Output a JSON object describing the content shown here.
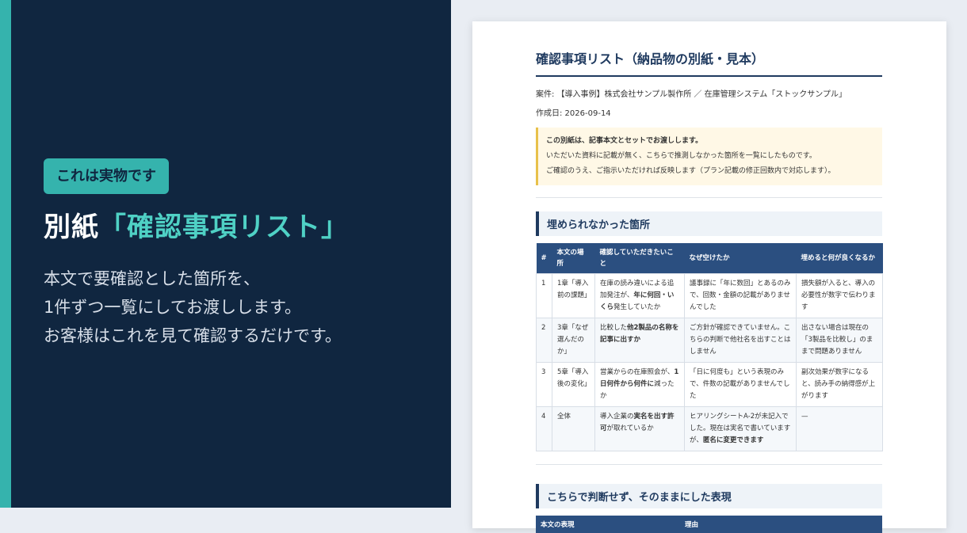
{
  "left": {
    "badge": "これは実物です",
    "headline_prefix": "別紙",
    "headline_highlight": "「確認事項リスト」",
    "lines": [
      "本文で要確認とした箇所を、",
      "1件ずつ一覧にしてお渡しします。",
      "お客様はこれを見て確認するだけです。"
    ]
  },
  "doc": {
    "title": "確認事項リスト（納品物の別紙・見本）",
    "case": "案件: 【導入事例】株式会社サンプル製作所 ／ 在庫管理システム「ストックサンプル」",
    "date": "作成日: 2026-09-14",
    "notice": {
      "line1": "この別紙は、記事本文とセットでお渡しします。",
      "line2": "いただいた資料に記載が無く、こちらで推測しなかった箇所を一覧にしたものです。",
      "line3": "ご確認のうえ、ご指示いただければ反映します（プラン記載の修正回数内で対応します）。"
    },
    "section1_title": "埋められなかった箇所",
    "table1": {
      "headers": [
        "#",
        "本文の場所",
        "確認していただきたいこと",
        "なぜ空けたか",
        "埋めると何が良くなるか"
      ],
      "rows": [
        {
          "num": "1",
          "place": "1章「導入前の課題」",
          "ask_a": "在庫の読み違いによる追加発注が、",
          "ask_b": "年に何回・いくら",
          "ask_c": "発生していたか",
          "why": "議事録に「年に数回」とあるのみで、回数・金額の記載がありませんでした",
          "benefit": "損失額が入ると、導入の必要性が数字で伝わります"
        },
        {
          "num": "2",
          "place": "3章「なぜ選んだのか」",
          "ask_a": "比較した",
          "ask_b": "他2製品の名称を記事に出すか",
          "ask_c": "",
          "why": "ご方針が確認できていません。こちらの判断で他社名を出すことはしません",
          "benefit": "出さない場合は現在の「3製品を比較し」のままで問題ありません"
        },
        {
          "num": "3",
          "place": "5章「導入後の変化」",
          "ask_a": "営業からの在庫照会が、",
          "ask_b": "1日何件から何件に",
          "ask_c": "減ったか",
          "why": "「日に何度も」という表現のみで、件数の記載がありませんでした",
          "benefit": "副次効果が数字になると、読み手の納得感が上がります"
        },
        {
          "num": "4",
          "place": "全体",
          "ask_a": "導入企業の",
          "ask_b": "実名を出す許可",
          "ask_c": "が取れているか",
          "why_a": "ヒアリングシートA-2が未記入でした。現在は実名で書いていますが、",
          "why_b": "匿名に変更できます",
          "benefit": "—"
        }
      ]
    },
    "section2_title": "こちらで判断せず、そのままにした表現",
    "table2": {
      "headers": [
        "本文の表現",
        "理由"
      ]
    }
  }
}
